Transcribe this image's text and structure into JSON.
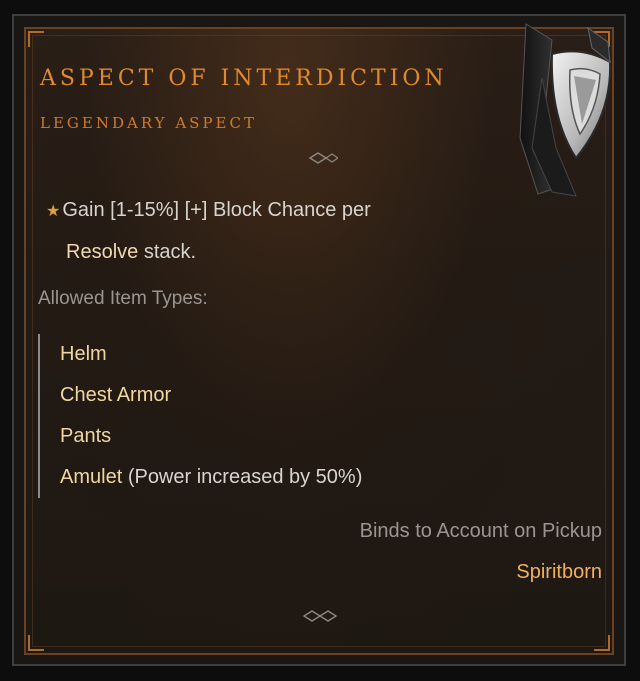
{
  "aspect": {
    "title": "ASPECT OF INTERDICTION",
    "type_label": "LEGENDARY ASPECT",
    "affix": {
      "prefix": "Gain [1-15%] [+] Block Chance per",
      "highlight": "Resolve",
      "suffix": "stack."
    },
    "allowed_label": "Allowed Item Types:",
    "item_types": [
      {
        "name": "Helm",
        "note": ""
      },
      {
        "name": "Chest Armor",
        "note": ""
      },
      {
        "name": "Pants",
        "note": ""
      },
      {
        "name": "Amulet",
        "note": "(Power increased by 50%)"
      }
    ],
    "binds": "Binds to Account on Pickup",
    "class": "Spiritborn"
  },
  "colors": {
    "legendary_orange": "#e08a2c",
    "item_type_gold": "#f0d6a0",
    "class_orange": "#f0b060",
    "muted_gray": "#9a9590",
    "body_text": "#d8d4cf"
  },
  "icons": [
    "shield-item-icon",
    "star-icon",
    "divider-ornament-icon"
  ]
}
